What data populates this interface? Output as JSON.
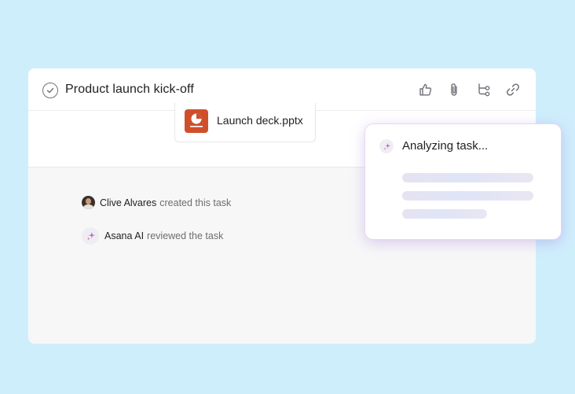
{
  "task": {
    "title": "Product launch kick-off",
    "header_actions": [
      {
        "icon": "thumbs-up-icon"
      },
      {
        "icon": "paperclip-icon"
      },
      {
        "icon": "subtask-icon"
      },
      {
        "icon": "link-icon"
      }
    ]
  },
  "attachment": {
    "name": "Launch deck.pptx",
    "icon": "powerpoint-file-icon",
    "icon_color": "#d04f2b"
  },
  "activity": [
    {
      "actor": "Clive Alvares",
      "action": "created this task"
    },
    {
      "actor": "Asana AI",
      "action": "reviewed the task"
    }
  ],
  "ai_popup": {
    "title": "Analyzing task...",
    "icon": "ai-sparkle-icon"
  },
  "colors": {
    "background": "#cfeefc",
    "accent_ai": "#c55fd6"
  }
}
